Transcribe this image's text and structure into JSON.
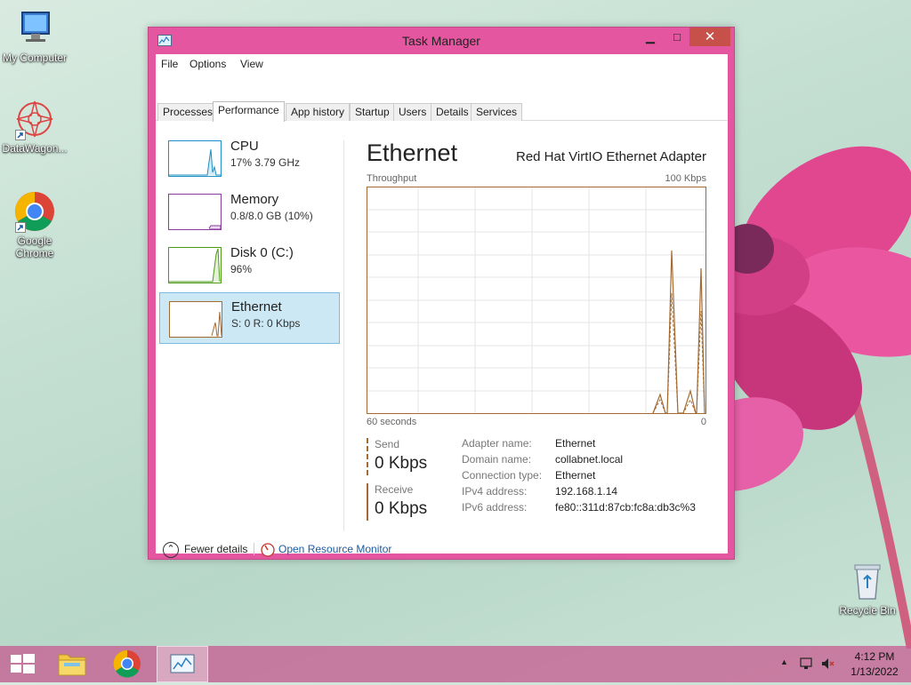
{
  "desktop": {
    "icons": [
      {
        "label": "My Computer",
        "icon": "computer-icon"
      },
      {
        "label": "DataWagon...",
        "icon": "datawagon-icon"
      },
      {
        "label": "Google Chrome",
        "icon": "chrome-icon"
      },
      {
        "label": "Recycle Bin",
        "icon": "recycle-bin-icon"
      }
    ]
  },
  "window": {
    "title": "Task Manager",
    "controls": {
      "minimize": "▁",
      "maximize": "□",
      "close": "✕"
    }
  },
  "menu": [
    "File",
    "Options",
    "View"
  ],
  "tabs": [
    "Processes",
    "Performance",
    "App history",
    "Startup",
    "Users",
    "Details",
    "Services"
  ],
  "active_tab": "Performance",
  "sidebar": [
    {
      "name": "CPU",
      "detail": "17% 3.79 GHz",
      "color": "#1f8fc5"
    },
    {
      "name": "Memory",
      "detail": "0.8/8.0 GB (10%)",
      "color": "#8b3a9e"
    },
    {
      "name": "Disk 0 (C:)",
      "detail": "96%",
      "color": "#4e9a18"
    },
    {
      "name": "Ethernet",
      "detail": "S: 0 R: 0 Kbps",
      "color": "#a36b32"
    }
  ],
  "panel": {
    "title": "Ethernet",
    "adapter": "Red Hat VirtIO Ethernet Adapter",
    "throughput_label": "Throughput",
    "max_scale": "100 Kbps",
    "time_span": "60 seconds",
    "min_scale": "0",
    "send_label": "Send",
    "send_value": "0 Kbps",
    "receive_label": "Receive",
    "receive_value": "0 Kbps",
    "properties": [
      {
        "label": "Adapter name:",
        "value": "Ethernet"
      },
      {
        "label": "Domain name:",
        "value": "collabnet.local"
      },
      {
        "label": "Connection type:",
        "value": "Ethernet"
      },
      {
        "label": "IPv4 address:",
        "value": "192.168.1.14"
      },
      {
        "label": "IPv6 address:",
        "value": "fe80::311d:87cb:fc8a:db3c%3"
      }
    ]
  },
  "footer": {
    "fewer_details": "Fewer details",
    "open_resource_monitor": "Open Resource Monitor"
  },
  "taskbar": {
    "time": "4:12 PM",
    "date": "1/13/2022"
  },
  "colors": {
    "window_frame": "#e4569f",
    "ethernet_line": "#a36b32",
    "selection_bg": "#cce8f4",
    "link": "#1a5aa0"
  }
}
